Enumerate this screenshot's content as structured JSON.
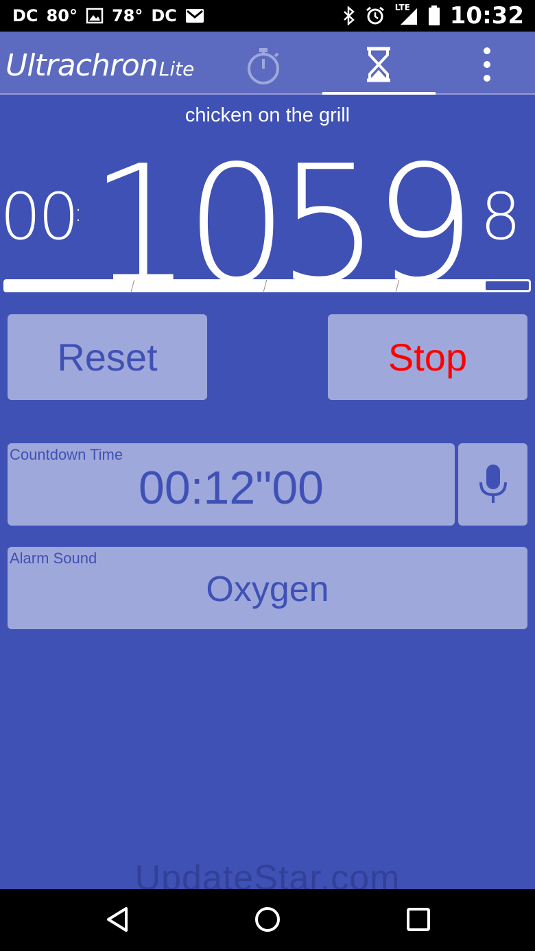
{
  "status_bar": {
    "left_items": [
      "DC",
      "80°",
      "78°",
      "DC"
    ],
    "time": "10:32",
    "network": "LTE"
  },
  "app_bar": {
    "logo_main": "Ultrachron",
    "logo_suffix": "Lite",
    "tabs": [
      {
        "icon": "stopwatch-icon",
        "selected": false
      },
      {
        "icon": "hourglass-icon",
        "selected": true
      }
    ],
    "menu_icon": "overflow-menu-icon"
  },
  "timer": {
    "label": "chicken on the grill",
    "hours": "00",
    "minutes": "10",
    "seconds": "59",
    "tenths": "8",
    "progress": 0.915
  },
  "buttons": {
    "reset": "Reset",
    "stop": "Stop"
  },
  "countdown": {
    "label": "Countdown Time",
    "value": "00:12\"00"
  },
  "alarm": {
    "label": "Alarm Sound",
    "value": "Oxygen"
  },
  "watermark": "UpdateStar.com",
  "colors": {
    "background": "#3f51b5",
    "app_bar": "#5c6bc0",
    "button": "#9fa8da",
    "stop_text": "#ff0000"
  }
}
